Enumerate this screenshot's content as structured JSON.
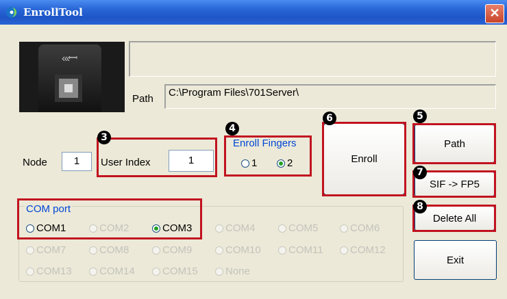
{
  "window": {
    "title": "EnrollTool",
    "close_glyph": "✕"
  },
  "status_text": "",
  "path": {
    "label": "Path",
    "value": "C:\\Program Files\\701Server\\"
  },
  "node": {
    "label": "Node",
    "value": "1"
  },
  "user_index": {
    "label": "User Index",
    "value": "1"
  },
  "enroll_fingers": {
    "legend": "Enroll Fingers",
    "options": [
      {
        "label": "1",
        "checked": false
      },
      {
        "label": "2",
        "checked": true
      }
    ]
  },
  "buttons": {
    "enroll": "Enroll",
    "path": "Path",
    "sif_fp5": "SIF -> FP5",
    "delete_all": "Delete All",
    "exit": "Exit"
  },
  "com_port": {
    "legend": "COM port",
    "options": [
      {
        "label": "COM1",
        "checked": false,
        "enabled": true
      },
      {
        "label": "COM2",
        "checked": false,
        "enabled": false
      },
      {
        "label": "COM3",
        "checked": true,
        "enabled": true
      },
      {
        "label": "COM4",
        "checked": false,
        "enabled": false
      },
      {
        "label": "COM5",
        "checked": false,
        "enabled": false
      },
      {
        "label": "COM6",
        "checked": false,
        "enabled": false
      },
      {
        "label": "COM7",
        "checked": false,
        "enabled": false
      },
      {
        "label": "COM8",
        "checked": false,
        "enabled": false
      },
      {
        "label": "COM9",
        "checked": false,
        "enabled": false
      },
      {
        "label": "COM10",
        "checked": false,
        "enabled": false
      },
      {
        "label": "COM11",
        "checked": false,
        "enabled": false
      },
      {
        "label": "COM12",
        "checked": false,
        "enabled": false
      },
      {
        "label": "COM13",
        "checked": false,
        "enabled": false
      },
      {
        "label": "COM14",
        "checked": false,
        "enabled": false
      },
      {
        "label": "COM15",
        "checked": false,
        "enabled": false
      },
      {
        "label": "None",
        "checked": false,
        "enabled": false
      }
    ]
  },
  "callouts": [
    "3",
    "4",
    "5",
    "6",
    "7",
    "8"
  ],
  "colors": {
    "title_bar": "#2b68d8",
    "callout_box": "#c1121f",
    "group_legend": "#0046d5"
  }
}
